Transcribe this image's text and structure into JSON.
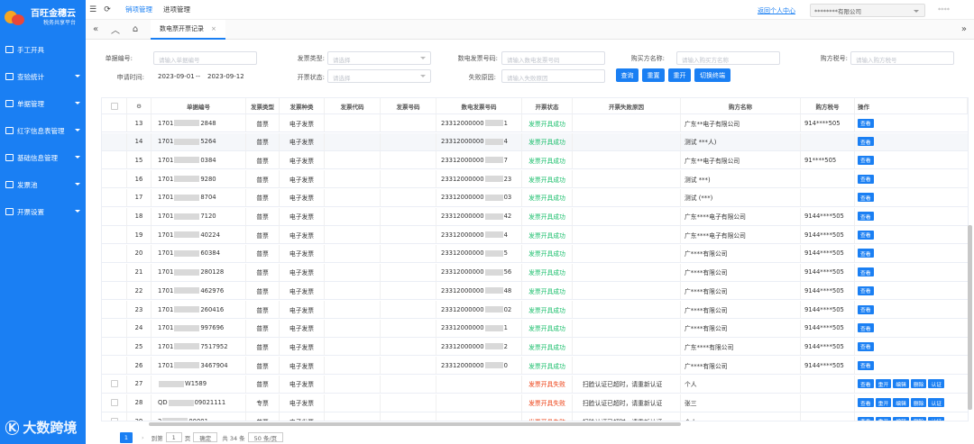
{
  "app": {
    "title": "百旺金穗云",
    "subtitle": "税务共享平台"
  },
  "sidebar": {
    "items": [
      {
        "label": "手工开具",
        "has_arrow": false
      },
      {
        "label": "查验统计",
        "has_arrow": true
      },
      {
        "label": "单据管理",
        "has_arrow": true
      },
      {
        "label": "红字信息表管理",
        "has_arrow": true
      },
      {
        "label": "基础信息管理",
        "has_arrow": true
      },
      {
        "label": "发票池",
        "has_arrow": true
      },
      {
        "label": "开票设置",
        "has_arrow": true
      }
    ]
  },
  "watermark": {
    "text": "大数跨境"
  },
  "topbar": {
    "tabs": [
      {
        "label": "销项管理",
        "active": true
      },
      {
        "label": "进项管理",
        "active": false
      }
    ],
    "back_link": "返回个人中心",
    "company": "********有限公司",
    "user": "****"
  },
  "tabbar": {
    "tab_label": "数电票开票记录"
  },
  "filters": {
    "labels": {
      "doc_no": "单据编号:",
      "invoice_type": "发票类型:",
      "digital_no": "数电发票号码:",
      "buyer_name": "购买方名称:",
      "buyer_tax": "购方税号:",
      "apply_time": "申请时间:",
      "status": "开票状态:",
      "fail_reason": "失败原因:"
    },
    "placeholders": {
      "doc_no": "请输入单据编号",
      "invoice_type": "请选择",
      "digital_no": "请输入数电发票号码",
      "buyer_name": "请输入购买方名称",
      "buyer_tax": "请输入购方税号",
      "status": "请选择",
      "fail_reason": "请输入失败原因"
    },
    "date_from": "2023-09-01",
    "date_sep": "--",
    "date_to": "2023-09-12",
    "buttons": {
      "query": "查询",
      "reset": "重置",
      "reissue": "重开",
      "switch": "切换终端"
    }
  },
  "table": {
    "headers": {
      "doc_no": "单据编号",
      "ticket_type": "发票类型",
      "kind": "发票种类",
      "code": "发票代码",
      "number": "发票号码",
      "digital_no": "数电发票号码",
      "status": "开票状态",
      "fail": "开票失败原因",
      "buyer": "购方名称",
      "tax": "购方税号",
      "ops": "操作"
    },
    "rows": [
      {
        "idx": "13",
        "doc_a": "1701",
        "doc_b": "2848",
        "type": "普票",
        "kind": "电子发票",
        "dig": "23312000000",
        "dig_b": "1",
        "status": "发票开具成功",
        "fail": "",
        "buyer": "广东**电子有限公司",
        "tax": "914****505",
        "ops": [
          "查看"
        ]
      },
      {
        "idx": "14",
        "doc_a": "1701",
        "doc_b": "5264",
        "type": "普票",
        "kind": "电子发票",
        "dig": "23312000000",
        "dig_b": "4",
        "status": "发票开具成功",
        "fail": "",
        "buyer": "测试 ***人)",
        "tax": "",
        "ops": [
          "查看"
        ],
        "hl": true
      },
      {
        "idx": "15",
        "doc_a": "1701",
        "doc_b": "0384",
        "type": "普票",
        "kind": "电子发票",
        "dig": "23312000000",
        "dig_b": "7",
        "status": "发票开具成功",
        "fail": "",
        "buyer": "广东**电子有限公司",
        "tax": "91****505",
        "ops": [
          "查看"
        ]
      },
      {
        "idx": "16",
        "doc_a": "1701",
        "doc_b": "9280",
        "type": "普票",
        "kind": "电子发票",
        "dig": "23312000000",
        "dig_b": "23",
        "status": "发票开具成功",
        "fail": "",
        "buyer": "测试 ***)",
        "tax": "",
        "ops": [
          "查看"
        ]
      },
      {
        "idx": "17",
        "doc_a": "1701",
        "doc_b": "8704",
        "type": "普票",
        "kind": "电子发票",
        "dig": "23312000000",
        "dig_b": "03",
        "status": "发票开具成功",
        "fail": "",
        "buyer": "测试 (***)",
        "tax": "",
        "ops": [
          "查看"
        ]
      },
      {
        "idx": "18",
        "doc_a": "1701",
        "doc_b": "7120",
        "type": "普票",
        "kind": "电子发票",
        "dig": "23312000000",
        "dig_b": "42",
        "status": "发票开具成功",
        "fail": "",
        "buyer": "广东****电子有限公司",
        "tax": "9144****505",
        "ops": [
          "查看"
        ]
      },
      {
        "idx": "19",
        "doc_a": "1701",
        "doc_b": "40224",
        "type": "普票",
        "kind": "电子发票",
        "dig": "23312000000",
        "dig_b": "4",
        "status": "发票开具成功",
        "fail": "",
        "buyer": "广东****电子有限公司",
        "tax": "9144****505",
        "ops": [
          "查看"
        ]
      },
      {
        "idx": "20",
        "doc_a": "1701",
        "doc_b": "60384",
        "type": "普票",
        "kind": "电子发票",
        "dig": "23312000000",
        "dig_b": "5",
        "status": "发票开具成功",
        "fail": "",
        "buyer": "广****有限公司",
        "tax": "9144****505",
        "ops": [
          "查看"
        ]
      },
      {
        "idx": "21",
        "doc_a": "1701",
        "doc_b": "280128",
        "type": "普票",
        "kind": "电子发票",
        "dig": "23312000000",
        "dig_b": "56",
        "status": "发票开具成功",
        "fail": "",
        "buyer": "广****有限公司",
        "tax": "9144****505",
        "ops": [
          "查看"
        ]
      },
      {
        "idx": "22",
        "doc_a": "1701",
        "doc_b": "462976",
        "type": "普票",
        "kind": "电子发票",
        "dig": "23312000000",
        "dig_b": "48",
        "status": "发票开具成功",
        "fail": "",
        "buyer": "广****有限公司",
        "tax": "9144****505",
        "ops": [
          "查看"
        ]
      },
      {
        "idx": "23",
        "doc_a": "1701",
        "doc_b": "260416",
        "type": "普票",
        "kind": "电子发票",
        "dig": "23312000000",
        "dig_b": "02",
        "status": "发票开具成功",
        "fail": "",
        "buyer": "广****有限公司",
        "tax": "9144****505",
        "ops": [
          "查看"
        ]
      },
      {
        "idx": "24",
        "doc_a": "1701",
        "doc_b": "997696",
        "type": "普票",
        "kind": "电子发票",
        "dig": "23312000000",
        "dig_b": "1",
        "status": "发票开具成功",
        "fail": "",
        "buyer": "广****有限公司",
        "tax": "9144****505",
        "ops": [
          "查看"
        ]
      },
      {
        "idx": "25",
        "doc_a": "1701",
        "doc_b": "7517952",
        "type": "普票",
        "kind": "电子发票",
        "dig": "23312000000",
        "dig_b": "2",
        "status": "发票开具成功",
        "fail": "",
        "buyer": "广东****有限公司",
        "tax": "9144****505",
        "ops": [
          "查看"
        ]
      },
      {
        "idx": "26",
        "doc_a": "1701",
        "doc_b": "3467904",
        "type": "普票",
        "kind": "电子发票",
        "dig": "23312000000",
        "dig_b": "0",
        "status": "发票开具成功",
        "fail": "",
        "buyer": "广****有限公司",
        "tax": "9144****505",
        "ops": [
          "查看"
        ]
      },
      {
        "idx": "27",
        "doc_a": "",
        "doc_b": "W1589",
        "type": "普票",
        "kind": "电子发票",
        "dig": "",
        "dig_b": "",
        "status": "发票开具失败",
        "fail": "扫脸认证已超时，请重新认证",
        "buyer": "个人",
        "tax": "",
        "ops": [
          "查看",
          "重开",
          "编辑",
          "删除",
          "认证"
        ],
        "checkbox": true
      },
      {
        "idx": "28",
        "doc_a": "QD",
        "doc_b": "09021111",
        "type": "专票",
        "kind": "电子发票",
        "dig": "",
        "dig_b": "",
        "status": "发票开具失败",
        "fail": "扫脸认证已超时，请重新认证",
        "buyer": "张三",
        "tax": "",
        "ops": [
          "查看",
          "重开",
          "编辑",
          "删除",
          "认证"
        ],
        "checkbox": true
      },
      {
        "idx": "29",
        "doc_a": "2",
        "doc_b": "00001",
        "type": "普票",
        "kind": "电子发票",
        "dig": "",
        "dig_b": "",
        "status": "发票开具失败",
        "fail": "扫脸认证已超时，请重新认证",
        "buyer": "个人",
        "tax": "",
        "ops": [
          "查看",
          "重开",
          "编辑",
          "删除",
          "认证"
        ],
        "checkbox": true
      }
    ]
  },
  "pager": {
    "current": "1",
    "goto_label": "到第",
    "page_input": "1",
    "page_unit": "页",
    "confirm": "确定",
    "total": "共 34 条",
    "page_size": "50 条/页"
  }
}
